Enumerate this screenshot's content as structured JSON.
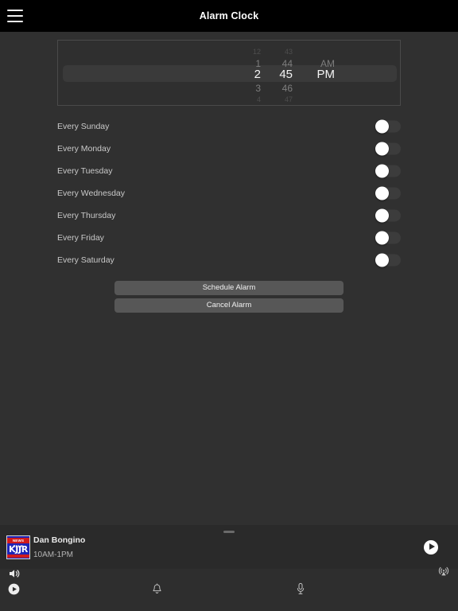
{
  "header": {
    "title": "Alarm Clock",
    "menu_icon": "hamburger-menu-icon"
  },
  "time_picker": {
    "hours": [
      "12",
      "1",
      "2",
      "3",
      "4"
    ],
    "minutes": [
      "43",
      "44",
      "45",
      "46",
      "47"
    ],
    "meridiem": [
      "",
      "AM",
      "PM",
      "",
      ""
    ],
    "selected": {
      "hour": "2",
      "minute": "45",
      "meridiem": "PM"
    }
  },
  "repeat_days": [
    {
      "label": "Every Sunday",
      "enabled": false
    },
    {
      "label": "Every Monday",
      "enabled": false
    },
    {
      "label": "Every Tuesday",
      "enabled": false
    },
    {
      "label": "Every Wednesday",
      "enabled": false
    },
    {
      "label": "Every Thursday",
      "enabled": false
    },
    {
      "label": "Every Friday",
      "enabled": false
    },
    {
      "label": "Every Saturday",
      "enabled": false
    }
  ],
  "actions": {
    "schedule_label": "Schedule Alarm",
    "cancel_label": "Cancel Alarm"
  },
  "now_playing": {
    "title": "Dan Bongino",
    "subtitle": "10AM-1PM",
    "station_banner": "NEWS TALK",
    "station_call": "KJJR",
    "play_icon": "play-icon",
    "drag_handle": "drag-handle"
  },
  "bottom_bar": {
    "volume_icon": "speaker-volume-icon",
    "cast_icon": "broadcast-cast-icon",
    "card_icon": "contact-card-icon",
    "play_icon": "play-icon",
    "alerts_icon": "bell-icon",
    "mic_icon": "microphone-icon"
  },
  "colors": {
    "header_bg": "#000000",
    "page_bg": "#303030",
    "button_bg": "#575757",
    "toggle_knob": "#ffffff",
    "logo_blue": "#1c24b8",
    "logo_red": "#d11b1b"
  }
}
